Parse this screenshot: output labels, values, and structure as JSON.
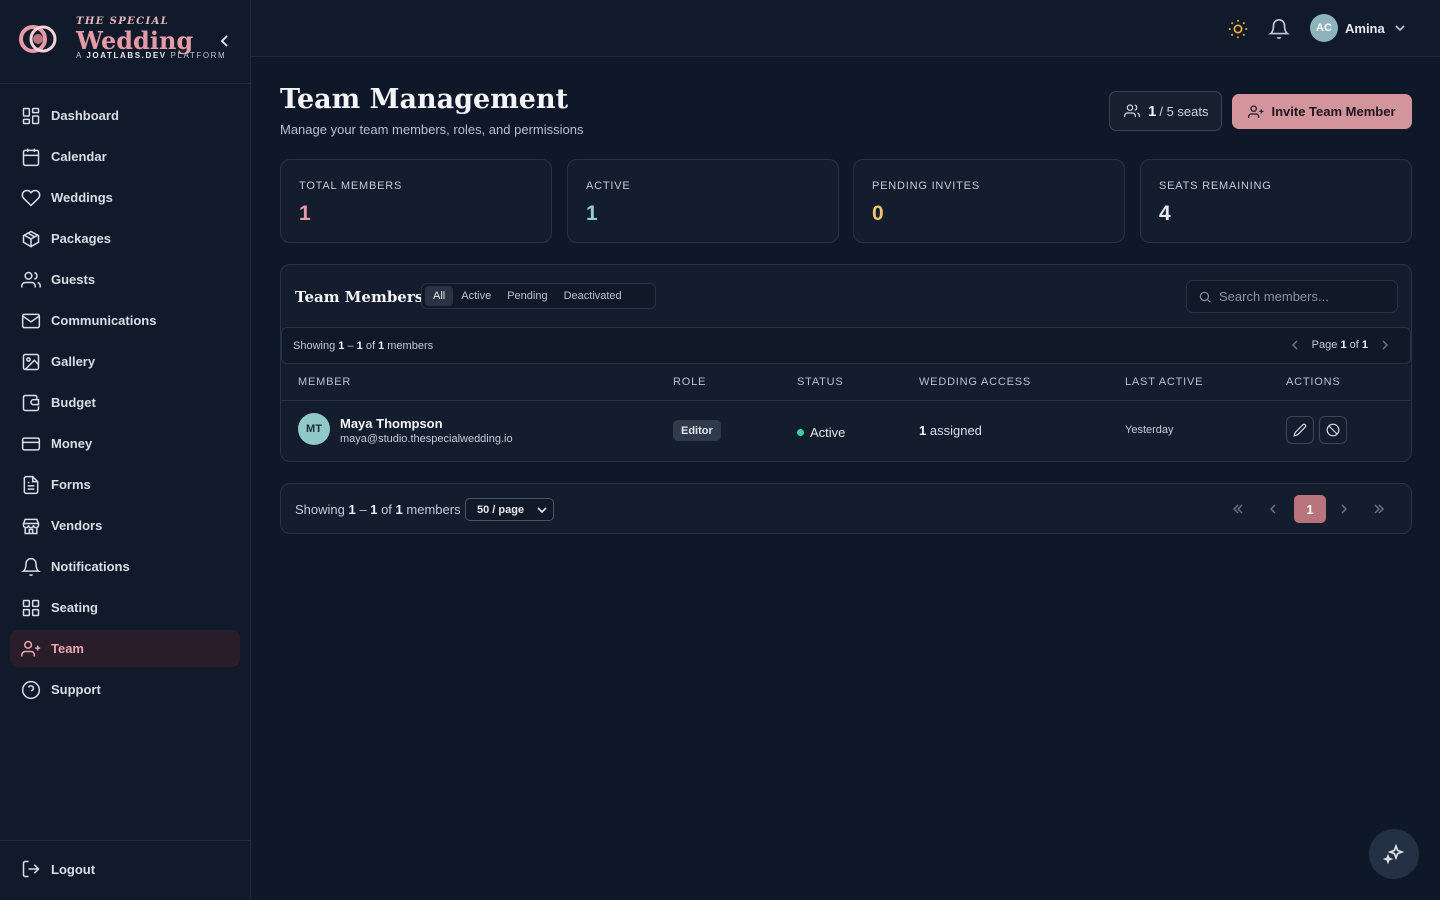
{
  "brand": {
    "kicker": "THE SPECIAL",
    "name": "Wedding",
    "sub_prefix": "A ",
    "sub_bold": "JOATLABS.DEV",
    "sub_suffix": " PLATFORM"
  },
  "sidebar": {
    "items": [
      {
        "label": "Dashboard",
        "icon": "grid-icon"
      },
      {
        "label": "Calendar",
        "icon": "calendar-icon"
      },
      {
        "label": "Weddings",
        "icon": "heart-icon"
      },
      {
        "label": "Packages",
        "icon": "package-icon"
      },
      {
        "label": "Guests",
        "icon": "users-icon"
      },
      {
        "label": "Communications",
        "icon": "mail-icon"
      },
      {
        "label": "Gallery",
        "icon": "image-icon"
      },
      {
        "label": "Budget",
        "icon": "wallet-icon"
      },
      {
        "label": "Money",
        "icon": "credit-card-icon"
      },
      {
        "label": "Forms",
        "icon": "file-text-icon"
      },
      {
        "label": "Vendors",
        "icon": "store-icon"
      },
      {
        "label": "Notifications",
        "icon": "bell-icon"
      },
      {
        "label": "Seating",
        "icon": "grid-icon"
      },
      {
        "label": "Team",
        "icon": "user-plus-icon",
        "active": true
      },
      {
        "label": "Support",
        "icon": "help-circle-icon"
      }
    ],
    "logout": "Logout"
  },
  "topbar": {
    "user_initials": "AC",
    "user_name": "Amina"
  },
  "page": {
    "title": "Team Management",
    "subtitle": "Manage your team members, roles, and permissions",
    "seats_used": "1",
    "seats_rest": "/ 5 seats",
    "invite_label": "Invite Team Member"
  },
  "stats": [
    {
      "label": "TOTAL MEMBERS",
      "value": "1",
      "color": "#e79aa6"
    },
    {
      "label": "ACTIVE",
      "value": "1",
      "color": "#8fd0d0"
    },
    {
      "label": "PENDING INVITES",
      "value": "0",
      "color": "#f5c26b"
    },
    {
      "label": "SEATS REMAINING",
      "value": "4",
      "color": "#e5e7eb"
    }
  ],
  "members": {
    "title": "Team Members",
    "tabs": [
      "All",
      "Active",
      "Pending",
      "Deactivated"
    ],
    "search_placeholder": "Search members...",
    "showing": {
      "prefix": "Showing",
      "from": "1",
      "dash": "–",
      "to": "1",
      "of": "of",
      "total": "1",
      "suffix": "members"
    },
    "page": {
      "prefix": "Page",
      "current": "1",
      "of": "of",
      "total": "1"
    },
    "headers": [
      "MEMBER",
      "ROLE",
      "STATUS",
      "WEDDING ACCESS",
      "LAST ACTIVE",
      "ACTIONS"
    ],
    "rows": [
      {
        "initials": "MT",
        "name": "Maya Thompson",
        "email": "maya@studio.thespecialwedding.io",
        "role": "Editor",
        "status": "Active",
        "access_count": "1",
        "access_label": "assigned",
        "last_active": "Yesterday"
      }
    ]
  },
  "footer": {
    "per_page": "50 / page",
    "current_page": "1"
  }
}
